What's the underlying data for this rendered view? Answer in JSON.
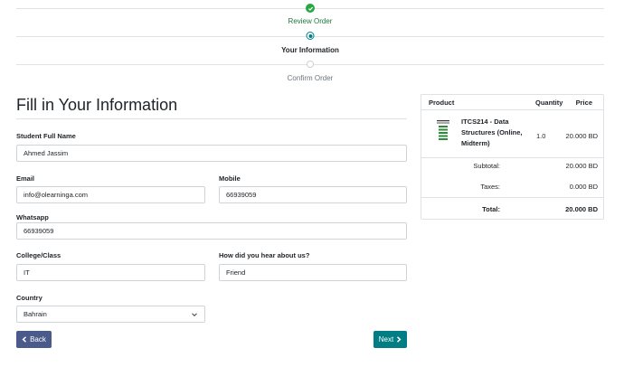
{
  "steps": [
    {
      "label": "Review Order",
      "state": "done"
    },
    {
      "label": "Your Information",
      "state": "active"
    },
    {
      "label": "Confirm Order",
      "state": "todo"
    }
  ],
  "page_title": "Fill in Your Information",
  "form": {
    "student_name": {
      "label": "Student Full Name",
      "value": "Ahmed Jassim"
    },
    "email": {
      "label": "Email",
      "value": "info@olearninga.com"
    },
    "mobile": {
      "label": "Mobile",
      "value": "66939059"
    },
    "whatsapp": {
      "label": "Whatsapp",
      "value": "66939059"
    },
    "college": {
      "label": "College/Class",
      "value": "IT"
    },
    "heard_about": {
      "label": "How did you hear about us?",
      "value": "Friend"
    },
    "country": {
      "label": "Country",
      "value": "Bahrain"
    }
  },
  "buttons": {
    "back": "Back",
    "next": "Next"
  },
  "cart": {
    "headers": {
      "product": "Product",
      "quantity": "Quantity",
      "price": "Price"
    },
    "item": {
      "name": "ITCS214 - Data Structures (Online, Midterm)",
      "quantity": "1.0",
      "price": "20.000 BD"
    },
    "subtotal": {
      "label": "Subtotal:",
      "value": "20.000 BD"
    },
    "taxes": {
      "label": "Taxes:",
      "value": "0.000 BD"
    },
    "total": {
      "label": "Total:",
      "value": "20.000 BD"
    }
  },
  "colors": {
    "success": "#28a745",
    "primary": "#017e84",
    "back_button": "#4a5a8a"
  }
}
